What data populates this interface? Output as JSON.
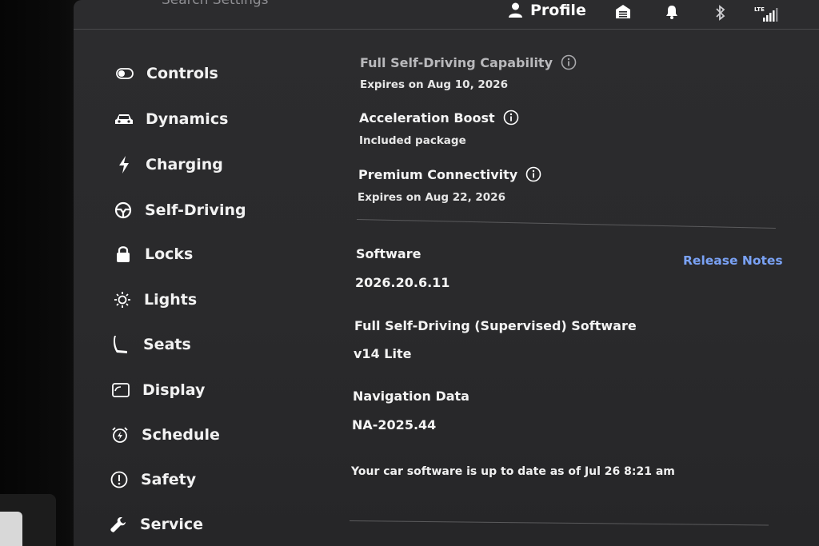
{
  "header": {
    "breadcrumb": "Search Settings",
    "profile_label": "Profile",
    "lte_label": "LTE"
  },
  "sidebar": {
    "items": [
      {
        "label": "Controls",
        "icon": "toggle-icon"
      },
      {
        "label": "Dynamics",
        "icon": "car-icon"
      },
      {
        "label": "Charging",
        "icon": "bolt-icon"
      },
      {
        "label": "Self-Driving",
        "icon": "steering-wheel-icon"
      },
      {
        "label": "Locks",
        "icon": "lock-icon"
      },
      {
        "label": "Lights",
        "icon": "sun-icon"
      },
      {
        "label": "Seats",
        "icon": "seat-icon"
      },
      {
        "label": "Display",
        "icon": "display-icon"
      },
      {
        "label": "Schedule",
        "icon": "alarm-clock-icon"
      },
      {
        "label": "Safety",
        "icon": "alert-circle-icon"
      },
      {
        "label": "Service",
        "icon": "wrench-icon"
      }
    ]
  },
  "upgrades": {
    "fsd": {
      "title": "Full Self-Driving Capability",
      "detail": "Expires on Aug 10, 2026"
    },
    "boost": {
      "title": "Acceleration Boost",
      "detail": "Included package"
    },
    "connectivity": {
      "title": "Premium Connectivity",
      "detail": "Expires on Aug 22, 2026"
    }
  },
  "software": {
    "label": "Software",
    "version": "2026.20.6.11",
    "release_notes_label": "Release Notes",
    "fsd_label": "Full Self-Driving (Supervised) Software",
    "fsd_version": "v14 Lite",
    "nav_label": "Navigation Data",
    "nav_version": "NA-2025.44",
    "status": "Your car software is up to date as of Jul 26 8:21 am"
  },
  "colors": {
    "background": "#2a2a2c",
    "accent_link": "#7aa2f5",
    "text": "#f4f4f4"
  }
}
